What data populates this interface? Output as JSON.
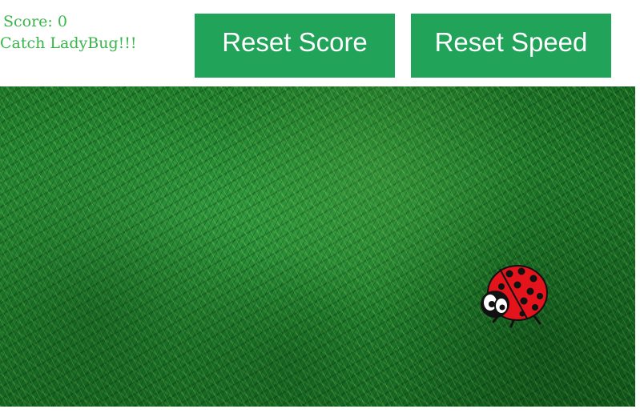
{
  "hud": {
    "score_label": "Score: 0",
    "title": "Catch LadyBug!!!",
    "text_color": "#39b54a"
  },
  "buttons": {
    "reset_score_label": "Reset Score",
    "reset_speed_label": "Reset Speed",
    "button_color": "#21a35a"
  },
  "game": {
    "background": "grass",
    "sprite": "ladybug",
    "sprite_colors": {
      "shell": "#e3141b",
      "spots": "#111111",
      "eyes": "#ffffff"
    }
  }
}
